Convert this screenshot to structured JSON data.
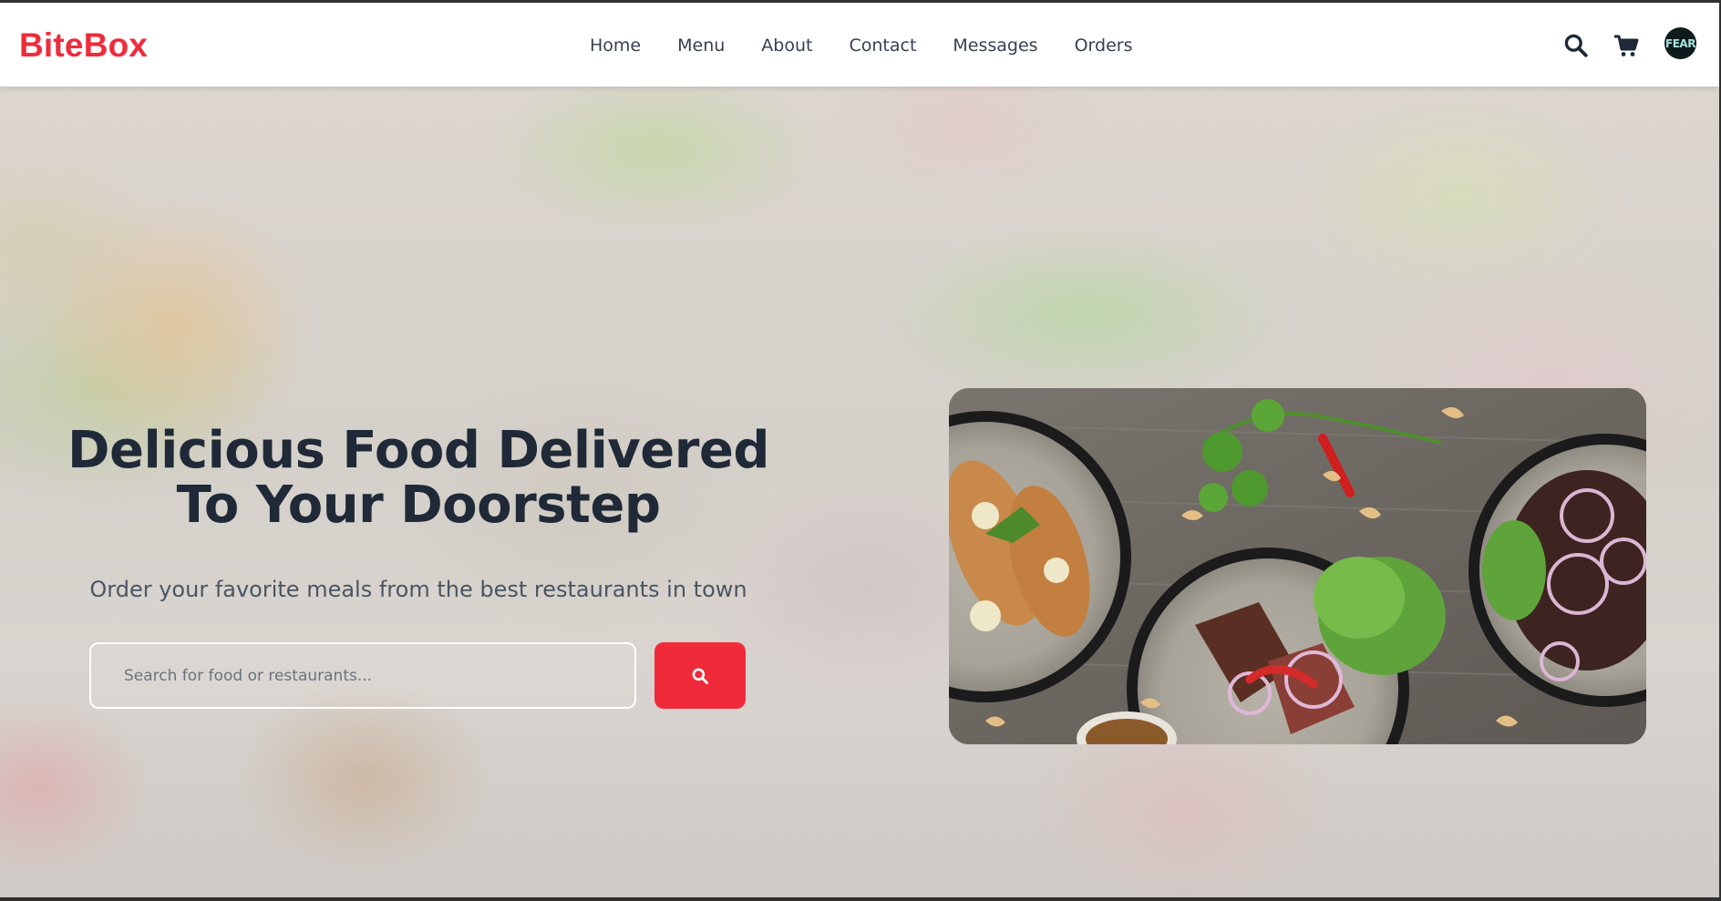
{
  "header": {
    "brand": "BiteBox",
    "nav": [
      "Home",
      "Menu",
      "About",
      "Contact",
      "Messages",
      "Orders"
    ],
    "icons": [
      "search-icon",
      "cart-icon"
    ],
    "avatar_text": "FEAR"
  },
  "hero": {
    "title": "Delicious Food Delivered To Your Doorstep",
    "subtitle": "Order your favorite meals from the best restaurants in town",
    "search_placeholder": "Search for food or restaurants...",
    "search_button_icon": "search-icon"
  },
  "colors": {
    "accent": "#ef2b3a",
    "text_dark": "#1f2937",
    "text_muted": "#4b5563"
  }
}
